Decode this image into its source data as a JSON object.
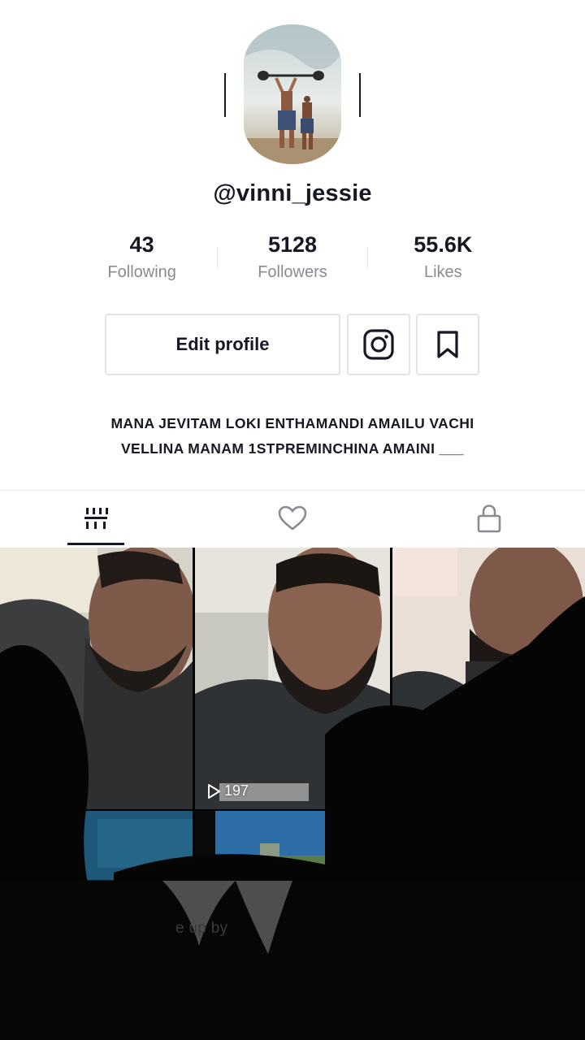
{
  "profile": {
    "username": "@vinni_jessie",
    "bio_line1": "MANA JEVITAM LOKI ENTHAMANDI AMAILU VACHI",
    "bio_line2": "VELLINA MANAM 1STPREMINCHINA AMAINI ___"
  },
  "stats": [
    {
      "value": "43",
      "label": "Following"
    },
    {
      "value": "5128",
      "label": "Followers"
    },
    {
      "value": "55.6K",
      "label": "Likes"
    }
  ],
  "actions": {
    "edit_label": "Edit profile",
    "instagram_icon": "instagram-icon",
    "bookmark_icon": "bookmark-icon"
  },
  "tabs": [
    {
      "icon": "videos-grid-icon",
      "selected": true
    },
    {
      "icon": "heart-icon",
      "selected": false
    },
    {
      "icon": "lock-icon",
      "selected": false
    }
  ],
  "videos": [
    {
      "views": ""
    },
    {
      "views": "197"
    },
    {
      "views": ""
    }
  ],
  "obscured_text": "e up        by",
  "colors": {
    "text_primary": "#161823",
    "text_secondary": "#8a8b91",
    "border": "#e3e3e4"
  }
}
